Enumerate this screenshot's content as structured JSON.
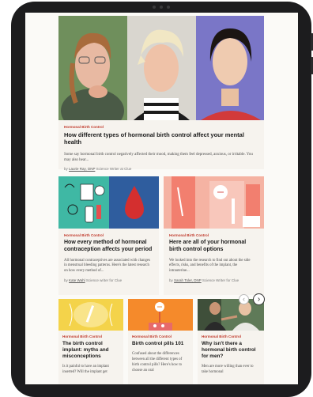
{
  "hero": {
    "category": "Hormonal Birth Control",
    "title": "How different types of hormonal birth control affect your mental health",
    "excerpt": "Some say hormonal birth control negatively affected their mood, making them feel depressed, anxious, or irritable. You may also hear...",
    "by": "by",
    "author": "Laurie Ray, DNP",
    "role": "Science Writer at Clue"
  },
  "cards": [
    {
      "category": "Hormonal Birth Control",
      "title": "How every method of hormonal contraception affects your period",
      "excerpt": "All hormonal contraceptives are associated with changes in menstrual bleeding patterns. Here's the latest research on how every method of...",
      "by": "by",
      "author": "Kate Wahl",
      "role": "Science writer for Clue"
    },
    {
      "category": "Hormonal Birth Control",
      "title": "Here are all of your hormonal birth control options",
      "excerpt": "We looked into the research to find out about the side effects, risks, and benefits of the implant, the intrauterine...",
      "by": "by",
      "author": "Sarah Toler, DNP",
      "role": "Science Writer for Clue"
    }
  ],
  "small_cards": [
    {
      "category": "Hormonal Birth Control",
      "title": "The birth control implant: myths and misconceptions",
      "excerpt": "Is it painful to have an implant inserted? Will the implant get"
    },
    {
      "category": "Hormonal Birth Control",
      "title": "Birth control pills 101",
      "excerpt": "Confused about the differences between all the different types of birth control pills? Here's how to choose an oral"
    },
    {
      "category": "Hormonal Birth Control",
      "title": "Why isn't there a hormonal birth control for men?",
      "excerpt": "Men are more willing than ever to take hormonal"
    }
  ],
  "nav": {
    "prev_icon": "chevron-left-icon",
    "next_icon": "chevron-right-icon",
    "prev_glyph": "‹",
    "next_glyph": "›"
  },
  "colors": {
    "accent": "#c0392b",
    "teal": "#3fb8a4",
    "blue": "#2f5d9e",
    "coral": "#f27f6f",
    "yellow": "#f4d34a",
    "orange": "#f58a2b"
  }
}
